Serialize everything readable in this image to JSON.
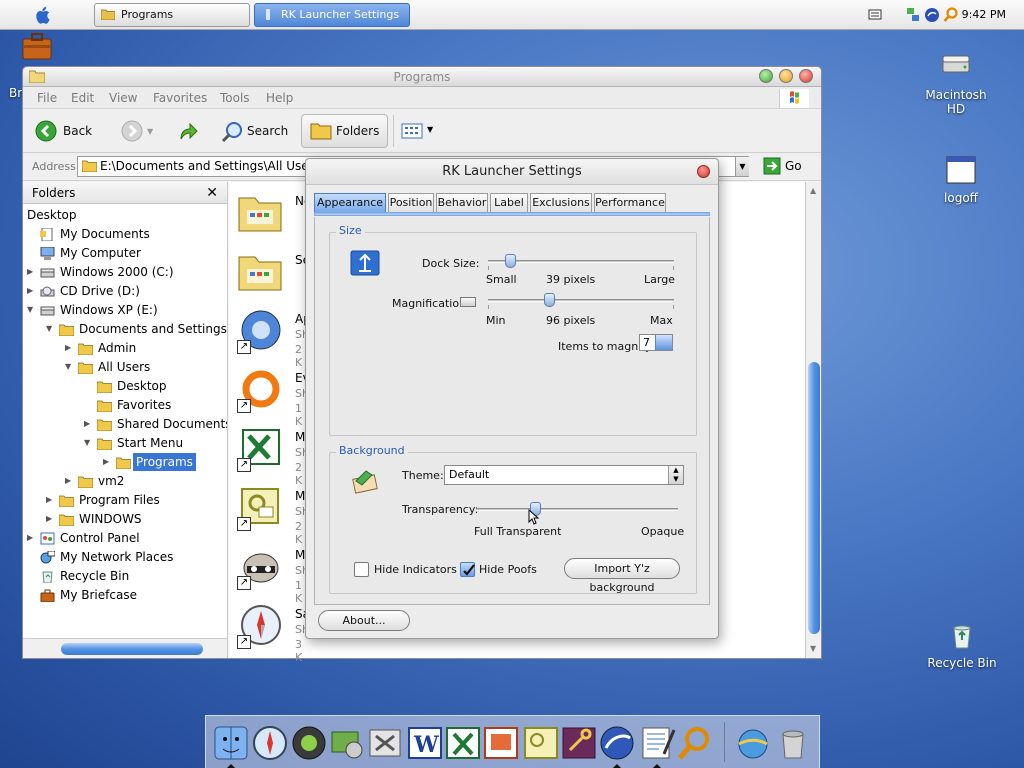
{
  "menubar": {
    "tasks": [
      {
        "label": "Programs",
        "active": false
      },
      {
        "label": "RK Launcher Settings",
        "active": true
      }
    ],
    "clock": "9:42 PM"
  },
  "desktop": {
    "icons": [
      {
        "label": "Macintosh HD",
        "icon": "hard-drive-icon"
      },
      {
        "label": "logoff",
        "icon": "window-icon"
      },
      {
        "label": "Recycle Bin",
        "icon": "recycle-bin-icon"
      }
    ],
    "partial_label": "Bri"
  },
  "explorer": {
    "title": "Programs",
    "menu": [
      "File",
      "Edit",
      "View",
      "Favorites",
      "Tools",
      "Help"
    ],
    "toolbar": {
      "back": "Back",
      "search": "Search",
      "folders": "Folders"
    },
    "address_label": "Address",
    "address_value": "E:\\Documents and Settings\\All User",
    "go": "Go",
    "folders_header": "Folders",
    "tree": [
      {
        "label": "Desktop",
        "level": 0,
        "arrow": "",
        "icon": "none"
      },
      {
        "label": "My Documents",
        "level": 0,
        "arrow": "",
        "icon": "documents-icon"
      },
      {
        "label": "My Computer",
        "level": 0,
        "arrow": "",
        "icon": "computer-icon"
      },
      {
        "label": "Windows 2000 (C:)",
        "level": 0,
        "arrow": "right",
        "icon": "drive-icon"
      },
      {
        "label": "CD Drive (D:)",
        "level": 0,
        "arrow": "right",
        "icon": "cd-icon"
      },
      {
        "label": "Windows XP (E:)",
        "level": 0,
        "arrow": "down",
        "icon": "drive-icon"
      },
      {
        "label": "Documents and Settings",
        "level": 1,
        "arrow": "down",
        "icon": "folder-icon"
      },
      {
        "label": "Admin",
        "level": 2,
        "arrow": "right",
        "icon": "folder-icon"
      },
      {
        "label": "All Users",
        "level": 2,
        "arrow": "down",
        "icon": "folder-icon"
      },
      {
        "label": "Desktop",
        "level": 3,
        "arrow": "",
        "icon": "folder-icon"
      },
      {
        "label": "Favorites",
        "level": 3,
        "arrow": "",
        "icon": "folder-icon"
      },
      {
        "label": "Shared Documents",
        "level": 3,
        "arrow": "right",
        "icon": "folder-icon"
      },
      {
        "label": "Start Menu",
        "level": 3,
        "arrow": "down",
        "icon": "folder-icon"
      },
      {
        "label": "Programs",
        "level": 4,
        "arrow": "right",
        "icon": "folder-icon",
        "selected": true
      },
      {
        "label": "vm2",
        "level": 2,
        "arrow": "right",
        "icon": "folder-icon"
      },
      {
        "label": "Program Files",
        "level": 1,
        "arrow": "right",
        "icon": "folder-icon"
      },
      {
        "label": "WINDOWS",
        "level": 1,
        "arrow": "right",
        "icon": "folder-icon"
      },
      {
        "label": "Control Panel",
        "level": 0,
        "arrow": "right",
        "icon": "control-panel-icon"
      },
      {
        "label": "My Network Places",
        "level": 0,
        "arrow": "",
        "icon": "network-icon"
      },
      {
        "label": "Recycle Bin",
        "level": 0,
        "arrow": "",
        "icon": "recycle-bin-icon"
      },
      {
        "label": "My Briefcase",
        "level": 0,
        "arrow": "",
        "icon": "briefcase-icon"
      }
    ],
    "files": [
      {
        "name": "Ne",
        "sub1": "",
        "sub2": "",
        "icon": "folder-icon"
      },
      {
        "name": "Sea",
        "sub1": "",
        "sub2": "",
        "icon": "folder-icon"
      },
      {
        "name": "Ap",
        "sub1": "Sho",
        "sub2": "2 K",
        "icon": "app-shortcut-icon"
      },
      {
        "name": "Eve",
        "sub1": "Sho",
        "sub2": "1 K",
        "icon": "ring-icon"
      },
      {
        "name": "Mic",
        "sub1": "Sho",
        "sub2": "2 K",
        "icon": "excel-icon"
      },
      {
        "name": "Mic",
        "sub1": "Sho",
        "sub2": "2 K",
        "icon": "publisher-icon"
      },
      {
        "name": "My",
        "sub1": "Sho",
        "sub2": "1 K",
        "icon": "raccoon-icon"
      },
      {
        "name": "Saf",
        "sub1": "Sho",
        "sub2": "3 K",
        "icon": "safari-icon"
      }
    ]
  },
  "rk": {
    "title": "RK Launcher Settings",
    "tabs": [
      "Appearance",
      "Position",
      "Behavior",
      "Label",
      "Exclusions",
      "Performance"
    ],
    "size_group": "Size",
    "dock_size_label": "Dock Size:",
    "dock_min": "Small",
    "dock_value_text": "39 pixels",
    "dock_max": "Large",
    "dock_level": 0.12,
    "mag_label": "Magnification:",
    "mag_min": "Min",
    "mag_value_text": "96 pixels",
    "mag_max": "Max",
    "mag_level": 0.33,
    "items_label": "Items to magnify:",
    "items_value": "7",
    "background_group": "Background",
    "theme_label": "Theme:",
    "theme_value": "Default",
    "transparency_label": "Transparency:",
    "trans_min": "Full Transparent",
    "trans_max": "Opaque",
    "trans_level": 0.29,
    "hide_indicators": "Hide Indicators",
    "hide_poofs": "Hide Poofs",
    "import_btn": "Import Y'z background",
    "about_btn": "About..."
  },
  "dock": {
    "items": [
      "finder-icon",
      "safari-icon",
      "itunes-icon",
      "iphoto-icon",
      "tools-icon",
      "word-icon",
      "excel-icon",
      "powerpoint-icon",
      "publisher-icon",
      "keychain-icon",
      "mail-icon",
      "textedit-icon",
      "sherlock-icon",
      "network-icon",
      "trash-icon"
    ]
  },
  "colors": {
    "accent": "#3875d7",
    "tab_active": "#7aaaec",
    "group_label": "#2a5cb0"
  }
}
